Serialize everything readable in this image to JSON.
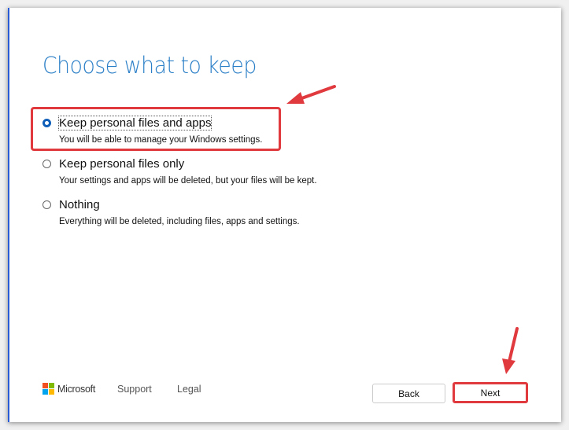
{
  "title": "Choose what to keep",
  "options": [
    {
      "label": "Keep personal files and apps",
      "description": "You will be able to manage your Windows settings.",
      "selected": true
    },
    {
      "label": "Keep personal files only",
      "description": "Your settings and apps will be deleted, but your files will be kept.",
      "selected": false
    },
    {
      "label": "Nothing",
      "description": "Everything will be deleted, including files, apps and settings.",
      "selected": false
    }
  ],
  "footer": {
    "brand": "Microsoft",
    "support": "Support",
    "legal": "Legal"
  },
  "buttons": {
    "back": "Back",
    "next": "Next"
  },
  "colors": {
    "accent": "#2b7fc7",
    "highlight": "#e0393e"
  }
}
